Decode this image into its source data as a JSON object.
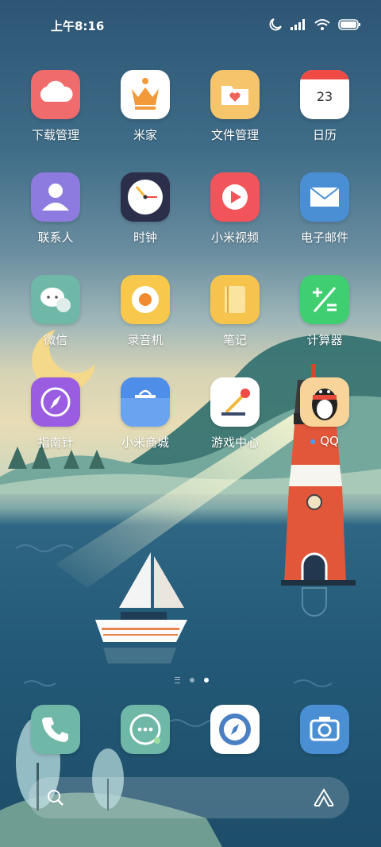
{
  "status": {
    "time": "上午8:16"
  },
  "apps": [
    {
      "id": "download",
      "label": "下载管理"
    },
    {
      "id": "mijia",
      "label": "米家"
    },
    {
      "id": "files",
      "label": "文件管理"
    },
    {
      "id": "calendar",
      "label": "日历",
      "date": "23"
    },
    {
      "id": "contacts",
      "label": "联系人"
    },
    {
      "id": "clock",
      "label": "时钟"
    },
    {
      "id": "video",
      "label": "小米视频"
    },
    {
      "id": "email",
      "label": "电子邮件"
    },
    {
      "id": "wechat",
      "label": "微信"
    },
    {
      "id": "recorder",
      "label": "录音机"
    },
    {
      "id": "notes",
      "label": "笔记"
    },
    {
      "id": "calculator",
      "label": "计算器"
    },
    {
      "id": "compass",
      "label": "指南针"
    },
    {
      "id": "mistore",
      "label": "小米商城"
    },
    {
      "id": "gamecenter",
      "label": "游戏中心"
    },
    {
      "id": "qq",
      "label": "QQ"
    }
  ],
  "page_indicator": {
    "pages": 2,
    "active": 2
  },
  "dock": [
    "phone",
    "messages",
    "browser",
    "camera"
  ],
  "colors": {
    "download": "#f06b6b",
    "files": "#f6c46a",
    "video": "#f2545b",
    "email": "#4a8fd3",
    "contacts": "#8e7be0",
    "wechat": "#6fb8a8",
    "calculator": "#3fcf70",
    "compass": "#9a5ce0",
    "mistore": "#4e8ee8"
  }
}
